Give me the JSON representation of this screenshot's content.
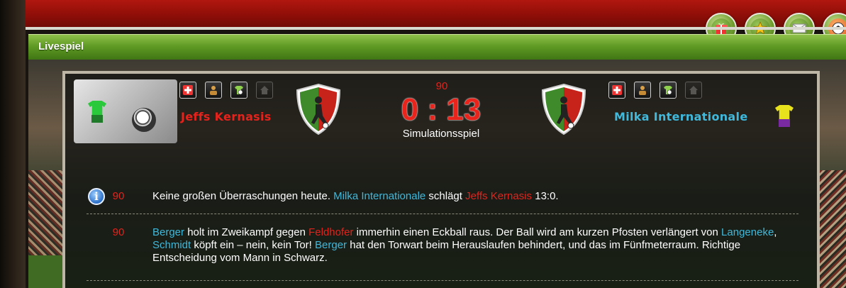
{
  "header": {
    "title": "Livespiel"
  },
  "nav": {
    "icons": [
      "gift-box-icon",
      "star-icon",
      "mail-icon",
      "soccer-ball-icon"
    ]
  },
  "match": {
    "minute": "90",
    "score": "0 : 13",
    "mode": "Simulationsspiel",
    "home_team": "Jeffs Kernasis",
    "away_team": "Milka Internationale",
    "home_color": "#e3231c",
    "away_color": "#3fb9dc"
  },
  "home_actions": [
    {
      "icon": "medical-cross-icon"
    },
    {
      "icon": "player-add-icon"
    },
    {
      "icon": "jersey-add-icon"
    },
    {
      "icon": "home-icon",
      "disabled": true
    }
  ],
  "away_actions": [
    {
      "icon": "medical-cross-icon"
    },
    {
      "icon": "player-add-icon"
    },
    {
      "icon": "jersey-add-icon"
    },
    {
      "icon": "home-icon",
      "disabled": true
    }
  ],
  "events": [
    {
      "minute": "90",
      "icon": "info-icon",
      "parts": [
        {
          "t": "Keine großen Überraschungen heute. ",
          "c": ""
        },
        {
          "t": "Milka Internationale",
          "c": "away"
        },
        {
          "t": " schlägt ",
          "c": ""
        },
        {
          "t": "Jeffs Kernasis",
          "c": "home"
        },
        {
          "t": " 13:0.",
          "c": ""
        }
      ]
    },
    {
      "minute": "90",
      "parts": [
        {
          "t": "Berger",
          "c": "away"
        },
        {
          "t": " holt im Zweikampf gegen ",
          "c": ""
        },
        {
          "t": "Feldhofer",
          "c": "home"
        },
        {
          "t": " immerhin einen Eckball raus. Der Ball wird am kurzen Pfosten verlängert von ",
          "c": ""
        },
        {
          "t": "Langeneke",
          "c": "away"
        },
        {
          "t": ", ",
          "c": ""
        },
        {
          "t": "Schmidt",
          "c": "away"
        },
        {
          "t": " köpft ein – nein, kein Tor! ",
          "c": ""
        },
        {
          "t": "Berger",
          "c": "away"
        },
        {
          "t": " hat den Torwart beim Herauslaufen behindert, und das im Fünfmeterraum. Richtige Entscheidung vom Mann in Schwarz.",
          "c": ""
        }
      ]
    }
  ]
}
